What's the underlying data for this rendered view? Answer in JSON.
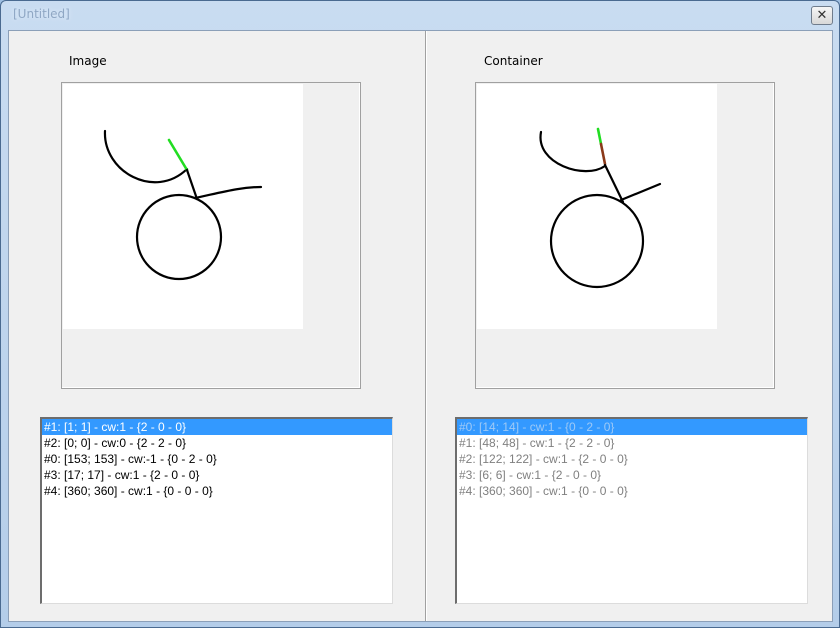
{
  "window": {
    "title": "[Untitled]",
    "close_glyph": "✕"
  },
  "left_panel": {
    "label": "Image",
    "list": [
      "#1: [1; 1] - cw:1 - {2 - 0 - 0}",
      "#2: [0; 0] - cw:0 - {2 - 2 - 0}",
      "#0: [153; 153] - cw:-1 - {0 - 2 - 0}",
      "#3: [17; 17] - cw:1 - {2 - 0 - 0}",
      "#4: [360; 360] - cw:1 - {0 - 0 - 0}"
    ],
    "selected_index": 0
  },
  "right_panel": {
    "label": "Container",
    "list": [
      "#0: [14; 14] - cw:1 - {0 - 2 - 0}",
      "#1: [48; 48] - cw:1 - {2 - 2 - 0}",
      "#2: [122; 122] - cw:1 - {2 - 0 - 0}",
      "#3: [6; 6] - cw:1 - {2 - 0 - 0}",
      "#4: [360; 360] - cw:1 - {0 - 0 - 0}"
    ],
    "selected_index": 0
  },
  "colors": {
    "highlight_green": "#22dd22",
    "highlight_brown": "#8b3a1a",
    "stroke": "#000000",
    "selection": "#3399ff"
  },
  "icons": {
    "close": "close-icon"
  }
}
